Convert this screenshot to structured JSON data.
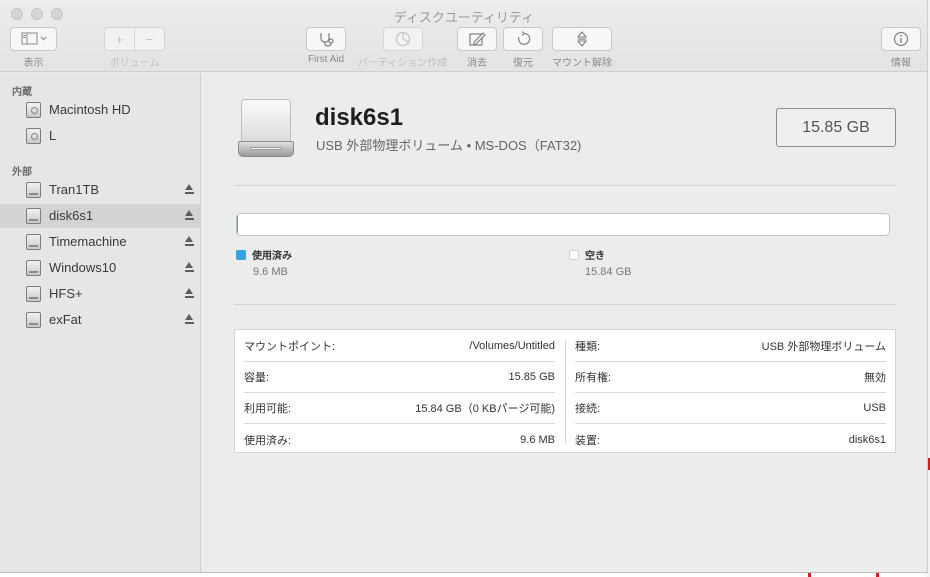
{
  "window": {
    "title": "ディスクユーティリティ"
  },
  "toolbar": {
    "view_label": "表示",
    "volume_label": "ボリューム",
    "firstaid_label": "First Aid",
    "partition_label": "パーティション作成",
    "erase_label": "消去",
    "restore_label": "復元",
    "unmount_label": "マウント解除",
    "info_label": "情報"
  },
  "sidebar": {
    "internal_title": "内蔵",
    "external_title": "外部",
    "internal": [
      {
        "label": "Macintosh HD"
      },
      {
        "label": "L"
      }
    ],
    "external": [
      {
        "label": "Tran1TB"
      },
      {
        "label": "disk6s1",
        "selected": true
      },
      {
        "label": "Timemachine"
      },
      {
        "label": "Windows10"
      },
      {
        "label": "HFS+"
      },
      {
        "label": "exFat"
      }
    ]
  },
  "disk": {
    "name": "disk6s1",
    "description": "USB 外部物理ボリューム • MS-DOS（FAT32)",
    "size": "15.85 GB"
  },
  "usage": {
    "used_label": "使用済み",
    "used_value": "9.6 MB",
    "free_label": "空き",
    "free_value": "15.84 GB",
    "used_fraction": 0.0006,
    "used_color": "#36a3e0",
    "free_color": "#ffffff"
  },
  "info": {
    "left": [
      {
        "key": "マウントポイント:",
        "value": "/Volumes/Untitled"
      },
      {
        "key": "容量:",
        "value": "15.85 GB"
      },
      {
        "key": "利用可能:",
        "value": "15.84 GB（0 KBパージ可能)"
      },
      {
        "key": "使用済み:",
        "value": "9.6 MB"
      }
    ],
    "right": [
      {
        "key": "種類:",
        "value": "USB 外部物理ボリューム"
      },
      {
        "key": "所有権:",
        "value": "無効"
      },
      {
        "key": "接続:",
        "value": "USB"
      },
      {
        "key": "装置:",
        "value": "disk6s1"
      }
    ]
  }
}
